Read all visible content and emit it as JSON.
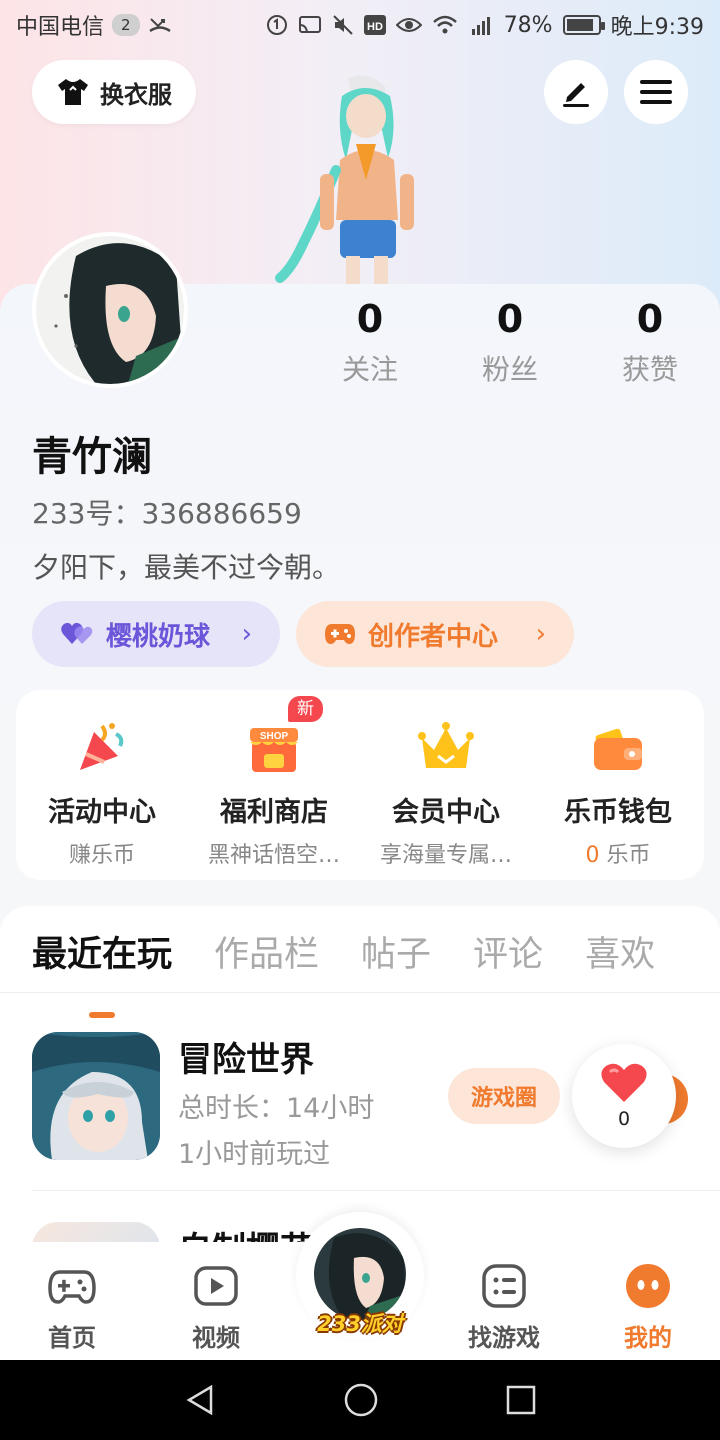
{
  "status_bar": {
    "carrier": "中国电信",
    "sim_slot": "2",
    "battery": "78%",
    "time": "晚上9:39"
  },
  "header": {
    "change_clothes_label": "换衣服"
  },
  "profile": {
    "stats": [
      {
        "count": "0",
        "label": "关注"
      },
      {
        "count": "0",
        "label": "粉丝"
      },
      {
        "count": "0",
        "label": "获赞"
      }
    ],
    "username": "青竹澜",
    "user_id": "233号：336886659",
    "signature": "夕阳下，最美不过今朝。",
    "pills": {
      "cherry_label": "樱桃奶球",
      "creator_label": "创作者中心"
    }
  },
  "quick_entries": [
    {
      "title": "活动中心",
      "subtitle": "赚乐币",
      "icon": "party-popper-icon"
    },
    {
      "title": "福利商店",
      "subtitle": "黑神话悟空…",
      "icon": "shop-icon",
      "badge": "新",
      "badge_sign": "SHOP"
    },
    {
      "title": "会员中心",
      "subtitle": "享海量专属…",
      "icon": "crown-icon"
    },
    {
      "title": "乐币钱包",
      "subtitle_num": "0",
      "subtitle_unit": "乐币",
      "icon": "wallet-icon"
    }
  ],
  "tabs": [
    {
      "label": "最近在玩",
      "active": true
    },
    {
      "label": "作品栏",
      "active": false
    },
    {
      "label": "帖子",
      "active": false
    },
    {
      "label": "评论",
      "active": false
    },
    {
      "label": "喜欢",
      "active": false
    }
  ],
  "recent_games": [
    {
      "name": "冒险世界",
      "playtime": "总时长：14小时",
      "last_played": "1小时前玩过",
      "action": "游戏圈"
    },
    {
      "name": "自制樱花"
    }
  ],
  "like_float": {
    "count": "0"
  },
  "bottom_nav": [
    {
      "label": "首页",
      "icon": "gamepad-icon",
      "active": false
    },
    {
      "label": "视频",
      "icon": "video-icon",
      "active": false
    },
    {
      "label": "233派对",
      "icon": "party-avatar-icon",
      "active": false
    },
    {
      "label": "找游戏",
      "icon": "list-icon",
      "active": false
    },
    {
      "label": "我的",
      "icon": "me-icon",
      "active": true
    }
  ],
  "colors": {
    "accent": "#f07a2e",
    "purple": "#6b55d9",
    "badge_red": "#f5484e"
  }
}
